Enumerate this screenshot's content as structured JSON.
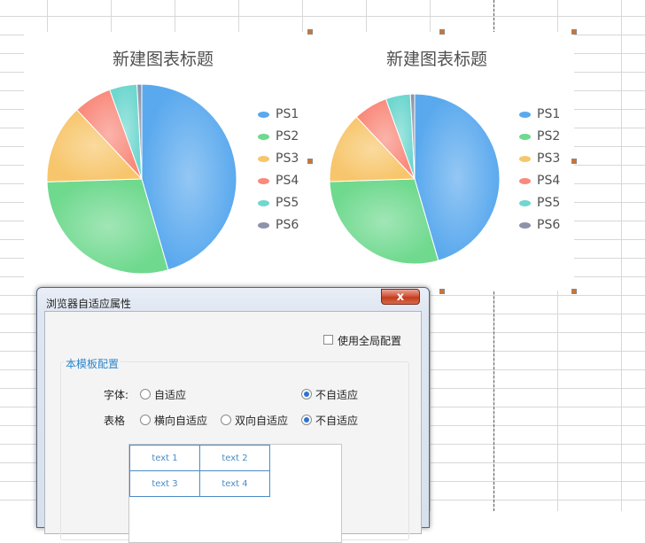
{
  "charts": [
    {
      "title": "新建图表标题",
      "legend": [
        "PS1",
        "PS2",
        "PS3",
        "PS4",
        "PS5",
        "PS6"
      ]
    },
    {
      "title": "新建图表标题",
      "legend": [
        "PS1",
        "PS2",
        "PS3",
        "PS4",
        "PS5",
        "PS6"
      ]
    }
  ],
  "chart_data": [
    {
      "type": "pie",
      "title": "新建图表标题",
      "labels": [
        "PS1",
        "PS2",
        "PS3",
        "PS4",
        "PS5",
        "PS6"
      ],
      "values": [
        45.5,
        29.0,
        13.5,
        6.5,
        4.7,
        0.8
      ],
      "colors": [
        "#5aa9ee",
        "#6fd98e",
        "#f7c66c",
        "#f98a7c",
        "#6fd7cf",
        "#8d93a8"
      ],
      "legend_position": "right"
    },
    {
      "type": "pie",
      "title": "新建图表标题",
      "labels": [
        "PS1",
        "PS2",
        "PS3",
        "PS4",
        "PS5",
        "PS6"
      ],
      "values": [
        45.5,
        29.0,
        13.5,
        6.5,
        4.7,
        0.8
      ],
      "colors": [
        "#5aa9ee",
        "#6fd98e",
        "#f7c66c",
        "#f98a7c",
        "#6fd7cf",
        "#8d93a8"
      ],
      "legend_position": "right"
    }
  ],
  "dialog": {
    "title": "浏览器自适应属性",
    "close_label": "x",
    "global_checkbox": {
      "label": "使用全局配置",
      "checked": false
    },
    "group_title": "本模板配置",
    "font_row": {
      "label": "字体:",
      "options": [
        {
          "label": "自适应",
          "selected": false
        },
        {
          "label": "不自适应",
          "selected": true
        }
      ]
    },
    "table_row": {
      "label": "表格",
      "options": [
        {
          "label": "横向自适应",
          "selected": false
        },
        {
          "label": "双向自适应",
          "selected": false
        },
        {
          "label": "不自适应",
          "selected": true
        }
      ]
    },
    "preview_cells": [
      [
        "text 1",
        "text 2"
      ],
      [
        "text 3",
        "text 4"
      ]
    ]
  }
}
